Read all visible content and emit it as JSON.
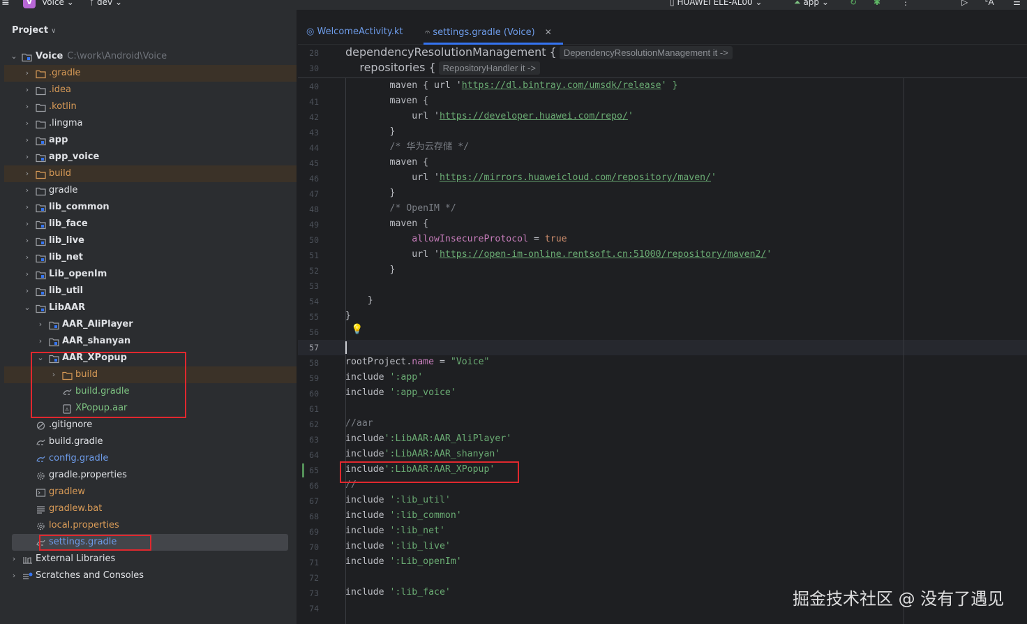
{
  "topbar": {
    "project_badge": "V",
    "project_name": "Voice",
    "branch": "dev",
    "device": "HUAWEI ELE-AL00",
    "run_config": "app"
  },
  "panel": {
    "title": "Project",
    "tree": [
      {
        "label": "Voice",
        "path": "C:\\work\\Android\\Voice"
      },
      {
        "label": ".gradle"
      },
      {
        "label": ".idea"
      },
      {
        "label": ".kotlin"
      },
      {
        "label": ".lingma"
      },
      {
        "label": "app"
      },
      {
        "label": "app_voice"
      },
      {
        "label": "build"
      },
      {
        "label": "gradle"
      },
      {
        "label": "lib_common"
      },
      {
        "label": "lib_face"
      },
      {
        "label": "lib_live"
      },
      {
        "label": "lib_net"
      },
      {
        "label": "Lib_openIm"
      },
      {
        "label": "lib_util"
      },
      {
        "label": "LibAAR"
      },
      {
        "label": "AAR_AliPlayer"
      },
      {
        "label": "AAR_shanyan"
      },
      {
        "label": "AAR_XPopup"
      },
      {
        "label": "build"
      },
      {
        "label": "build.gradle"
      },
      {
        "label": "XPopup.aar"
      },
      {
        "label": ".gitignore"
      },
      {
        "label": "build.gradle"
      },
      {
        "label": "config.gradle"
      },
      {
        "label": "gradle.properties"
      },
      {
        "label": "gradlew"
      },
      {
        "label": "gradlew.bat"
      },
      {
        "label": "local.properties"
      },
      {
        "label": "settings.gradle"
      },
      {
        "label": "External Libraries"
      },
      {
        "label": "Scratches and Consoles"
      }
    ]
  },
  "editor": {
    "tabs": [
      {
        "label": "WelcomeActivity.kt"
      },
      {
        "label": "settings.gradle (Voice)"
      }
    ],
    "sticky": [
      {
        "num": "28",
        "code": "dependencyResolutionManagement {",
        "hint": "DependencyResolutionManagement it ->"
      },
      {
        "num": "30",
        "code": "    repositories {",
        "hint": "RepositoryHandler it ->"
      }
    ],
    "lines": {
      "l40": {
        "num": "40",
        "a": "        maven { url '",
        "url": "https://dl.bintray.com/umsdk/release",
        "b": "' }"
      },
      "l41": {
        "num": "41",
        "a": "        maven {"
      },
      "l42": {
        "num": "42",
        "a": "            url '",
        "url": "https://developer.huawei.com/repo/",
        "b": "'"
      },
      "l43": {
        "num": "43",
        "a": "        }"
      },
      "l44": {
        "num": "44",
        "a": "        /* 华为云存储 */"
      },
      "l45": {
        "num": "45",
        "a": "        maven {"
      },
      "l46": {
        "num": "46",
        "a": "            url '",
        "url": "https://mirrors.huaweicloud.com/repository/maven/",
        "b": "'"
      },
      "l47": {
        "num": "47",
        "a": "        }"
      },
      "l48": {
        "num": "48",
        "a": "        /* OpenIM */"
      },
      "l49": {
        "num": "49",
        "a": "        maven {"
      },
      "l50": {
        "num": "50",
        "pre": "            ",
        "prop": "allowInsecureProtocol",
        "mid": " = ",
        "kw": "true"
      },
      "l51": {
        "num": "51",
        "a": "            url '",
        "url": "https://open-im-online.rentsoft.cn:51000/repository/maven2/",
        "b": "'"
      },
      "l52": {
        "num": "52",
        "a": "        }"
      },
      "l53": {
        "num": "53",
        "a": ""
      },
      "l54": {
        "num": "54",
        "a": "    }"
      },
      "l55": {
        "num": "55",
        "a": "}"
      },
      "l56": {
        "num": "56",
        "a": ""
      },
      "l57": {
        "num": "57",
        "a": ""
      },
      "l58": {
        "num": "58",
        "pre": "rootProject.",
        "prop": "name",
        "mid": " = ",
        "str": "\"Voice\""
      },
      "l59": {
        "num": "59",
        "a": "include ",
        "str": "':app'"
      },
      "l60": {
        "num": "60",
        "a": "include ",
        "str": "':app_voice'"
      },
      "l61": {
        "num": "61",
        "a": ""
      },
      "l62": {
        "num": "62",
        "cm": "//aar"
      },
      "l63": {
        "num": "63",
        "a": "include",
        "str": "':LibAAR:AAR_AliPlayer'"
      },
      "l64": {
        "num": "64",
        "a": "include",
        "str": "':LibAAR:AAR_shanyan'"
      },
      "l65": {
        "num": "65",
        "a": "include",
        "str": "':LibAAR:AAR_XPopup'"
      },
      "l66": {
        "num": "66",
        "cm": "//"
      },
      "l67": {
        "num": "67",
        "a": "include ",
        "str": "':lib_util'"
      },
      "l68": {
        "num": "68",
        "a": "include ",
        "str": "':lib_common'"
      },
      "l69": {
        "num": "69",
        "a": "include ",
        "str": "':lib_net'"
      },
      "l70": {
        "num": "70",
        "a": "include ",
        "str": "':lib_live'"
      },
      "l71": {
        "num": "71",
        "a": "include ",
        "str": "':Lib_openIm'"
      },
      "l72": {
        "num": "72",
        "a": ""
      },
      "l73": {
        "num": "73",
        "a": "include ",
        "str": "':lib_face'"
      },
      "l74": {
        "num": "74",
        "a": ""
      }
    }
  },
  "watermark": "掘金技术社区 @ 没有了遇见",
  "colors": {
    "accent": "#3574f0",
    "highlight_box": "#e0282e",
    "string": "#6aab73",
    "keyword": "#cf8e6d",
    "excluded_folder": "#d99b57",
    "vcs_added": "#7ec482",
    "vcs_modified": "#6d9be8"
  }
}
